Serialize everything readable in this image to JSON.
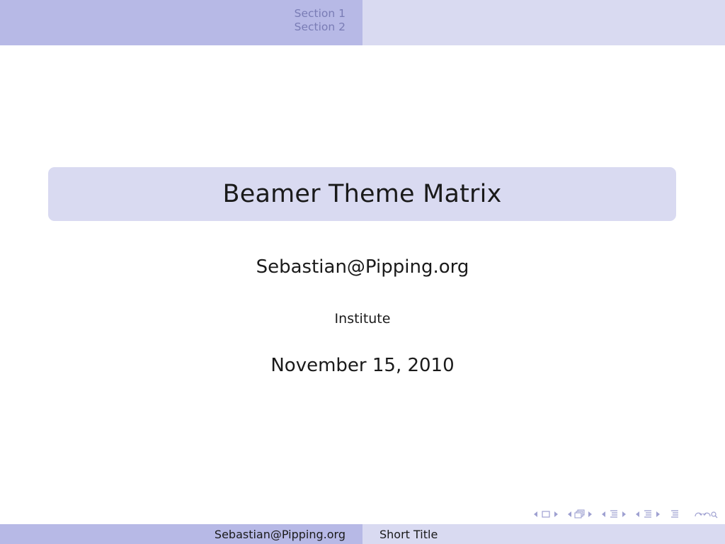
{
  "header": {
    "sections": [
      {
        "label": "Section 1"
      },
      {
        "label": "Section 2"
      }
    ]
  },
  "title_page": {
    "title": "Beamer Theme Matrix",
    "author": "Sebastian@Pipping.org",
    "institute": "Institute",
    "date": "November 15, 2010"
  },
  "navigation": {
    "icons": [
      "frame-nav-icon",
      "subsection-nav-icon",
      "section-nav-icon",
      "document-nav-icon",
      "back-forward-icon"
    ],
    "color": "#9fa1d1"
  },
  "footer": {
    "author": "Sebastian@Pipping.org",
    "short_title": "Short Title"
  },
  "colors": {
    "dark_band": "#b7b9e6",
    "light_band": "#d9daf1",
    "section_text": "#797cb5"
  }
}
